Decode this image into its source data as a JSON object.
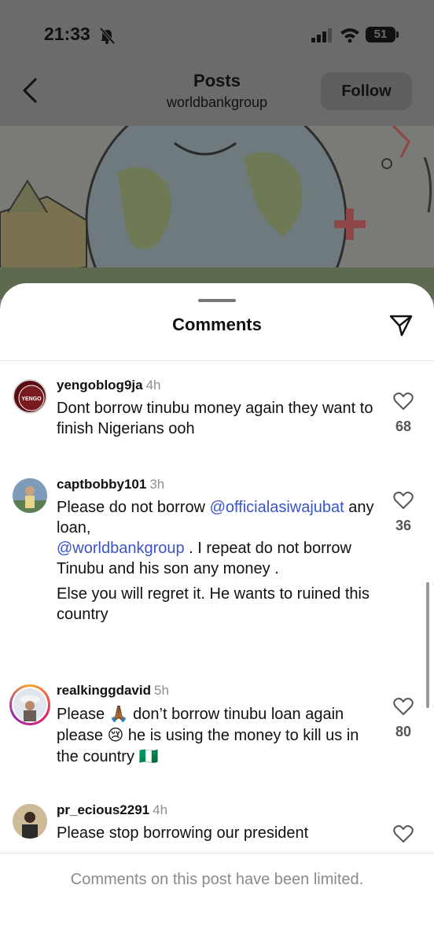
{
  "status_bar": {
    "time": "21:33",
    "battery": "51"
  },
  "header": {
    "title": "Posts",
    "subtitle": "worldbankgroup",
    "follow_label": "Follow"
  },
  "sheet": {
    "title": "Comments"
  },
  "comments": [
    {
      "user": "yengoblog9ja",
      "time": "4h",
      "avatar_text": "YENGO",
      "text": "Dont borrow tinubu money again they want to finish Nigerians ooh",
      "likes": "68"
    },
    {
      "user": "captbobby101",
      "time": "3h",
      "text_1a": "Please do not borrow ",
      "mention_1": "@officialasiwajubat",
      "text_1b": "  any loan,",
      "mention_2": "@worldbankgroup",
      "text_1c": " . I repeat do not borrow Tinubu and his son any money .",
      "text_2": "Else you will regret it. He wants to ruined this country",
      "likes": "36"
    },
    {
      "user": "realkinggdavid",
      "time": "5h",
      "text_a": "Please ",
      "emoji_1": "🙏🏾",
      "text_b": " don’t borrow tinubu loan again please ",
      "emoji_2": "😢",
      "text_c": " he is using the money to kill us in the country ",
      "emoji_3": "🇳🇬",
      "likes": "80"
    },
    {
      "user": "pr_ecious2291",
      "time": "4h",
      "text": "Please stop borrowing our president"
    }
  ],
  "footer": {
    "text": "Comments on this post have been limited."
  }
}
